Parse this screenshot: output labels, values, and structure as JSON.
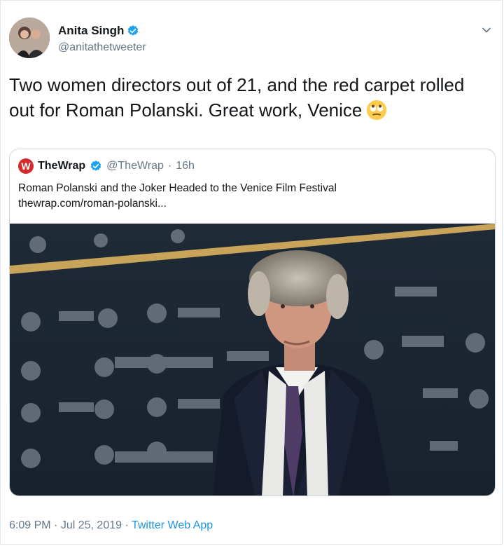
{
  "author": {
    "name": "Anita Singh",
    "handle": "@anitathetweeter",
    "avatar_icon": "user-avatar",
    "verified": true
  },
  "tweet": {
    "text": "Two women directors out of 21, and the red carpet rolled out for Roman Polanski. Great work, Venice",
    "emoji": "face-with-rolling-eyes"
  },
  "quoted_tweet": {
    "logo_letter": "W",
    "name": "TheWrap",
    "handle": "@TheWrap",
    "separator": "·",
    "time": "16h",
    "text_line1": "Roman Polanski and the Joker Headed to the Venice Film Festival",
    "text_line2": "thewrap.com/roman-polanski...",
    "image_icon": "red-carpet-photo"
  },
  "footer": {
    "time": "6:09 PM",
    "separator1": "·",
    "date": "Jul 25, 2019",
    "separator2": "·",
    "app": "Twitter Web App"
  },
  "colors": {
    "link_blue": "#1b95e0",
    "verified_blue": "#1da1f2",
    "muted": "#657786",
    "brand_red": "#d62a2a"
  }
}
